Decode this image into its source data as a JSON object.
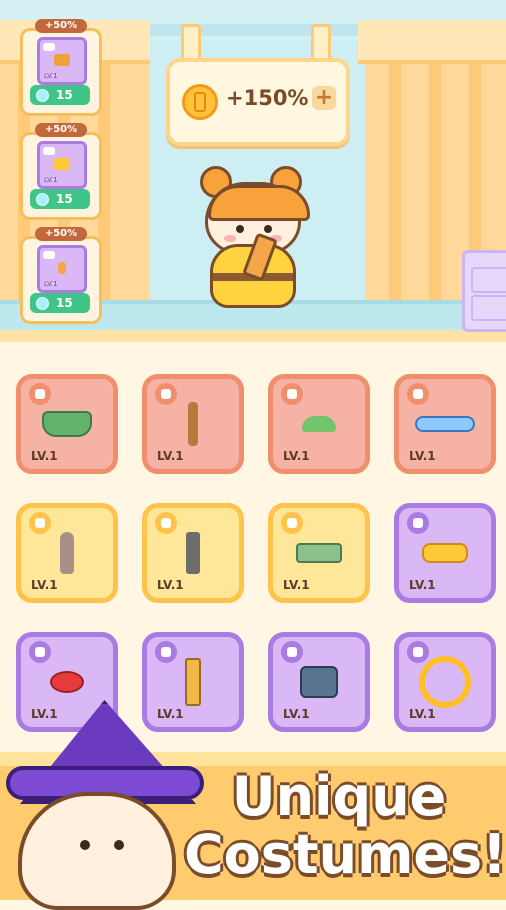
{
  "booth": {
    "bonus_text": "+150%",
    "plus_label": "+"
  },
  "slots": [
    {
      "badge": "+50%",
      "level": "LV.1",
      "price": "15",
      "item": "bow"
    },
    {
      "badge": "+50%",
      "level": "LV.1",
      "price": "15",
      "item": "bread"
    },
    {
      "badge": "+50%",
      "level": "LV.1",
      "price": "15",
      "item": "spatula"
    }
  ],
  "inventory": {
    "rows": [
      [
        {
          "level": "LV.1",
          "category": "lock",
          "item": "green-skirt",
          "tone": "red"
        },
        {
          "level": "LV.1",
          "category": "tool",
          "item": "brush",
          "tone": "red"
        },
        {
          "level": "LV.1",
          "category": "chef",
          "item": "green-hat",
          "tone": "red"
        },
        {
          "level": "LV.1",
          "category": "lock",
          "item": "scarf",
          "tone": "red"
        }
      ],
      [
        {
          "level": "LV.1",
          "category": "tool",
          "item": "trowel",
          "tone": "yellow"
        },
        {
          "level": "LV.1",
          "category": "tool",
          "item": "spatula",
          "tone": "yellow"
        },
        {
          "level": "LV.1",
          "category": "lock",
          "item": "green-top",
          "tone": "yellow"
        },
        {
          "level": "LV.1",
          "category": "lock",
          "item": "bread",
          "tone": "purple"
        }
      ],
      [
        {
          "level": "LV.1",
          "category": "chef",
          "item": "beret",
          "tone": "purple"
        },
        {
          "level": "LV.1",
          "category": "tool",
          "item": "knife",
          "tone": "purple"
        },
        {
          "level": "LV.1",
          "category": "tool",
          "item": "boots",
          "tone": "purple"
        },
        {
          "level": "LV.1",
          "category": "chef",
          "item": "ring",
          "tone": "purple"
        }
      ]
    ]
  },
  "promo": {
    "line1": "Unique",
    "line2": "Costumes!"
  },
  "colors": {
    "red_card": "#f6b2a5",
    "yellow_card": "#ffe79a",
    "purple_card": "#d9b8f5",
    "price_green": "#41c487"
  }
}
